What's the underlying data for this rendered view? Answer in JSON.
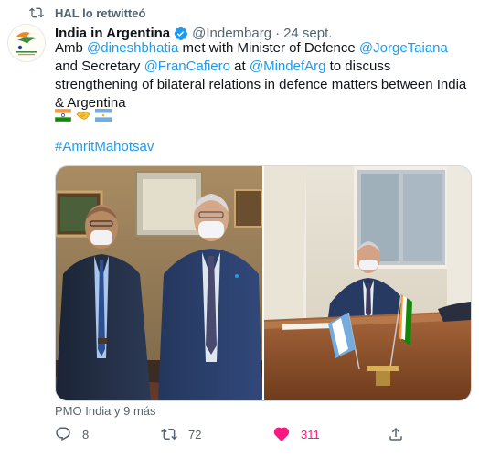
{
  "retweet": {
    "label": "HAL lo retwitteó"
  },
  "author": {
    "name": "India in Argentina",
    "handle": "@Indembarg",
    "date": "24 sept."
  },
  "tweet": {
    "parts": {
      "p1": "Amb ",
      "m1": "@dineshbhatia",
      "p2": " met with Minister of Defence ",
      "m2": "@JorgeTaiana",
      "p3": " and Secretary ",
      "m3": "@FranCafiero",
      "p4": " at ",
      "m4": "@MindefArg",
      "p5": " to discuss strengthening of bilateral relations in defence matters between India & Argentina"
    },
    "emojis": [
      "flag-india",
      "handshake",
      "flag-argentina"
    ],
    "hashtag": "#AmritMahotsav"
  },
  "media": {
    "tagged": "PMO India y 9 más"
  },
  "actions": {
    "replies": "8",
    "retweets": "72",
    "likes": "311"
  },
  "colors": {
    "accent": "#1d9bf0",
    "like": "#f91880",
    "muted": "#536471"
  }
}
